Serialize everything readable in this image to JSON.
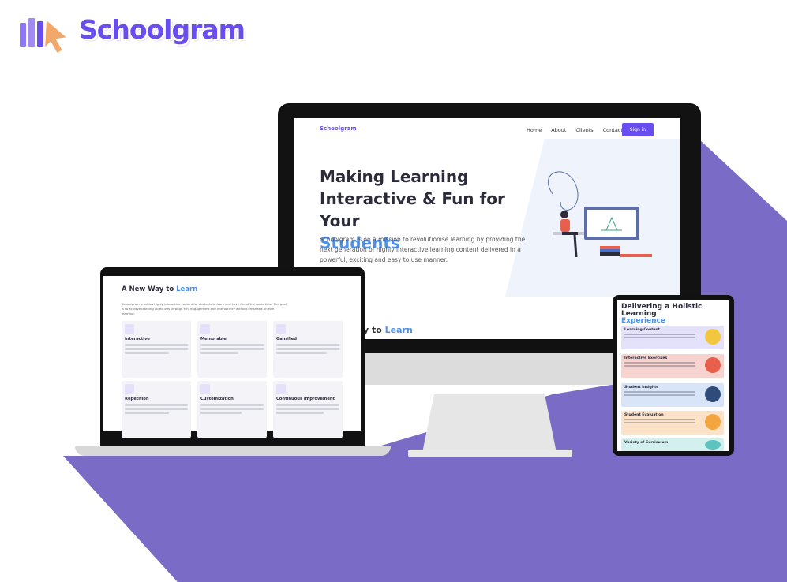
{
  "brand": {
    "name": "Schoolgram",
    "accent": "#6a4dee",
    "blue": "#4e90e6",
    "backdrop": "#7a6bc6"
  },
  "monitor": {
    "logo": "Schoolgram",
    "nav": [
      "Home",
      "About",
      "Clients",
      "Contact"
    ],
    "signin": "Sign in",
    "hero_line1": "Making Learning",
    "hero_line2": "Interactive & Fun for Your",
    "hero_line3": "Students",
    "hero_paragraph": "Schoolgram is on a mission to revolutionise learning by providing the next generation of highly interactive learning content delivered in a powerful, exciting and easy to use manner.",
    "section_fragment_a": "y to ",
    "section_fragment_b": "Learn"
  },
  "laptop": {
    "heading_a": "A New Way to ",
    "heading_b": "Learn",
    "intro": "Schoolgram provides highly interactive content for students to learn and have fun at the same time. The goal is to achieve learning objectives through fun, engagement and interactivity without emphasis on rote learning.",
    "cards": [
      "Interactive",
      "Memorable",
      "Gamified",
      "Repetition",
      "Customization",
      "Continuous Improvement"
    ]
  },
  "tablet": {
    "heading_a": "Delivering a Holistic Learning",
    "heading_b": "Experience",
    "cards": [
      {
        "title": "Learning Content",
        "color": "#e4e1fb",
        "icon": "#f3c640"
      },
      {
        "title": "Interactive Exercises",
        "color": "#f6d3cf",
        "icon": "#e8604c"
      },
      {
        "title": "Student Insights",
        "color": "#d8e4f8",
        "icon": "#2e4b7a"
      },
      {
        "title": "Student Evaluation",
        "color": "#fbe2c8",
        "icon": "#f3a640"
      },
      {
        "title": "Variety of Curriculum",
        "color": "#d3f0ee",
        "icon": "#5cc3c0"
      }
    ]
  }
}
